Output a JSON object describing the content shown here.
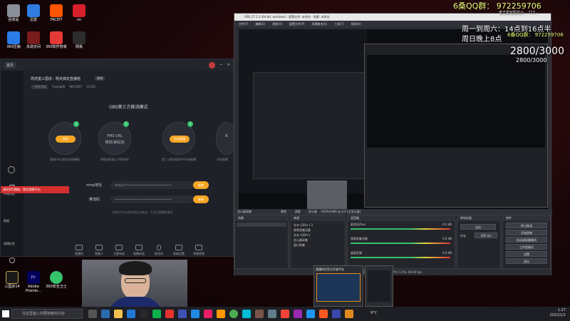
{
  "overlay": {
    "qq_group": "6桑QQ群： 972259706",
    "schedule_weekday": "周一到周六：14点到16点半",
    "schedule_sunday": "周日晚上8点",
    "sub_count": "2800/3000",
    "mini_qq": "6桑QQ群： 972259706",
    "mini_count": "2800/3000",
    "mini_top": "老王爱玩阳光小... 777..."
  },
  "desktop_icons": [
    {
      "label": "回收站",
      "color": "#8a8f99"
    },
    {
      "label": "迅雷",
      "color": "#2f7de1"
    },
    {
      "label": "FACEIT",
      "color": "#ff5500"
    },
    {
      "label": "nn",
      "color": "#d8202c"
    },
    {
      "label": "360压缩",
      "color": "#2a7de8"
    },
    {
      "label": "永劫无间",
      "color": "#7a1c1c"
    },
    {
      "label": "360软件管家",
      "color": "#e53935"
    },
    {
      "label": "网易",
      "color": "#2c2c2c"
    }
  ],
  "desktop_bottom_icons": [
    {
      "label": "三国杀14",
      "color": "#1a1a1a"
    },
    {
      "label": "Adobe Premie...",
      "color": "#00005b"
    },
    {
      "label": "360安全卫士",
      "color": "#35c36c"
    }
  ],
  "stream_app": {
    "tab": "首页",
    "room_title": "周虎墨三国杀：明天搞定直播啦",
    "room_tag": "修改",
    "tags": [
      "三国杀官网",
      "Fuying06",
      "9873407",
      "11316"
    ],
    "mode_title": "OBS第三方推流模式",
    "steps": [
      {
        "num": "1",
        "label": "复制",
        "caption": "复制rtmp地址和直播码"
      },
      {
        "num": "2",
        "label": "FMS URL",
        "sub": "推流/串码流",
        "caption": "将推流码填入OBS软件"
      },
      {
        "num": "3",
        "label": "开始直播",
        "caption": "第三方推流软件中开始直播"
      },
      {
        "num": "",
        "label": "B",
        "caption": "开始直播"
      }
    ],
    "rtmp_label": "rtmp地址",
    "rtmp_value": "rtmp://••••••••••••••••••••••••••••",
    "key_label": "推流码",
    "key_value": "••••••••••••••••••••••••••••••••••",
    "copy_label": "复制",
    "hint": "未填写rtmp地址将无法推流，下次无需重新填写",
    "notice": "请同学们播放，规定直播平台。",
    "toolbar": [
      "直播间",
      "观看人",
      "主题布局",
      "直播封面",
      "麦克风",
      "高级设置",
      "背景视频"
    ],
    "side_items": [
      "开播设置",
      "数据",
      "直播信息",
      "录播管理"
    ]
  },
  "obs": {
    "window_title": "OBS 27.1.3 (64-bit, windows) - 配置文件: 未命名 - 场景: 未命名",
    "menu": [
      "文件(F)",
      "编辑(E)",
      "视图(V)",
      "配置文件(P)",
      "场景集合(S)",
      "工具(T)",
      "帮助(H)"
    ],
    "source_bar_label": "显示器采集",
    "props_label": "属性",
    "filter_label": "滤镜",
    "display_label": "显示器",
    "display_value": "1920x1080 @ 0,0 (主显示器)",
    "panels": {
      "scenes": "场景",
      "sources": "来源",
      "mixer": "混音器",
      "transitions": "转场动画",
      "controls": "控件"
    },
    "sources": [
      "文本 (GDI+) 3",
      "视频采集设备",
      "文本 (GDI+)",
      "显示器采集",
      "窗口采集"
    ],
    "mixer_tracks": [
      {
        "name": "麦克风/Aux",
        "db": "0.0 dB"
      },
      {
        "name": "视频采集设备",
        "db": "0.0 dB"
      },
      {
        "name": "桌面音频",
        "db": "0.0 dB"
      }
    ],
    "transition_value": "淡出",
    "duration_label": "时长",
    "duration_value": "300 ms",
    "controls": [
      "停止推流",
      "开始录制",
      "启动虚拟摄像机",
      "工作室模式",
      "设置",
      "退出"
    ],
    "status": "LIVE: 00:00:00   REC: 00:00:00   CPU: 1.0%, 60.00 fps"
  },
  "taskbar": {
    "search_placeholder": "在这里输入你要搜索的内容",
    "time": "1:27",
    "date": "2022/1/1",
    "weather": "9°C",
    "preview_title": "直播伴侣官方开放平台"
  },
  "colors": {
    "accent": "#f5a623",
    "live_red": "#d32f2f",
    "green": "#35c36c"
  }
}
